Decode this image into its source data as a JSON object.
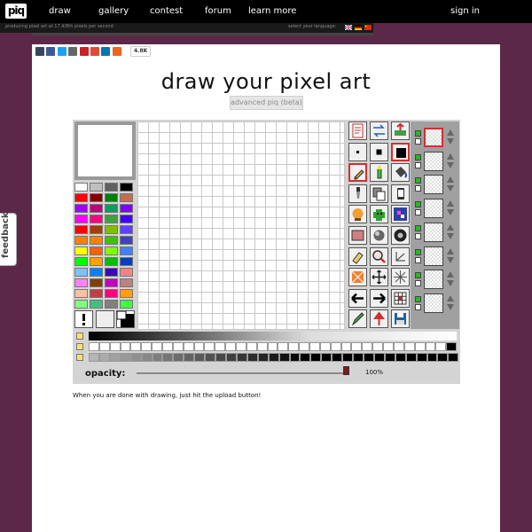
{
  "brand": {
    "logo_text": "piq"
  },
  "nav": {
    "items": [
      {
        "label": "draw"
      },
      {
        "label": "gallery"
      },
      {
        "label": "contest"
      },
      {
        "label": "forum"
      },
      {
        "label": "learn more"
      }
    ],
    "signin": "sign in"
  },
  "subbar": {
    "tagline": "producing pixel art at 17.4/8th pixels per second",
    "language_label": "select your language:",
    "flags": [
      "uk-flag",
      "de-flag",
      "cn-flag"
    ]
  },
  "share": {
    "buttons": [
      {
        "icon": "tumblr-icon",
        "color": "#36465d"
      },
      {
        "icon": "facebook-icon",
        "color": "#3b5998"
      },
      {
        "icon": "twitter-icon",
        "color": "#1da1f2"
      },
      {
        "icon": "email-icon",
        "color": "#666666"
      },
      {
        "icon": "pinterest-icon",
        "color": "#cb2027"
      },
      {
        "icon": "google-plus-icon",
        "color": "#dd4b39"
      },
      {
        "icon": "linkedin-icon",
        "color": "#0077b5"
      },
      {
        "icon": "share-plus-icon",
        "color": "#f16522"
      }
    ],
    "count": "4.8K"
  },
  "page": {
    "title": "draw your pixel art",
    "advanced_button": "advanced piq (beta)",
    "hint": "When you are done with drawing, just hit the upload button!"
  },
  "palette": {
    "colors": [
      [
        "#ffffff",
        "#c0c0c0",
        "#606060",
        "#000000"
      ],
      [
        "#ff0000",
        "#800000",
        "#008000",
        "#c07050"
      ],
      [
        "#a000ff",
        "#c00080",
        "#00a060",
        "#8000ff"
      ],
      [
        "#ff00ff",
        "#ff0080",
        "#40a040",
        "#4000ff"
      ],
      [
        "#ff0000",
        "#a04000",
        "#80c000",
        "#6040ff"
      ],
      [
        "#ff8000",
        "#ff8000",
        "#40c000",
        "#4040c0"
      ],
      [
        "#ffff00",
        "#ff6000",
        "#80ff00",
        "#4080ff"
      ],
      [
        "#00ff00",
        "#ffa000",
        "#00c000",
        "#0040c0"
      ],
      [
        "#80c0ff",
        "#0080ff",
        "#4000c0",
        "#ff8080"
      ],
      [
        "#ff80ff",
        "#804000",
        "#c000c0",
        "#c08080"
      ],
      [
        "#ffc0a0",
        "#c04040",
        "#ff0080",
        "#ffa000"
      ],
      [
        "#80ff80",
        "#40c080",
        "#808080",
        "#40ff40"
      ]
    ]
  },
  "tools": {
    "items": [
      {
        "name": "new-canvas-icon",
        "selected": false
      },
      {
        "name": "flip-icon",
        "selected": false
      },
      {
        "name": "upload-icon",
        "selected": false
      },
      {
        "name": "brush-small-icon",
        "selected": false
      },
      {
        "name": "brush-medium-icon",
        "selected": false
      },
      {
        "name": "brush-large-icon",
        "selected": true
      },
      {
        "name": "pencil-icon",
        "selected": true
      },
      {
        "name": "color-pencil-icon",
        "selected": false
      },
      {
        "name": "paint-bucket-icon",
        "selected": false
      },
      {
        "name": "dropper-icon",
        "selected": false
      },
      {
        "name": "copy-icon",
        "selected": false
      },
      {
        "name": "phone-icon",
        "selected": false
      },
      {
        "name": "stamp-icon",
        "selected": false
      },
      {
        "name": "sprite-icon",
        "selected": false
      },
      {
        "name": "pattern-icon",
        "selected": false
      },
      {
        "name": "fill-rect-icon",
        "selected": false
      },
      {
        "name": "sphere-icon",
        "selected": false
      },
      {
        "name": "gradient-icon",
        "selected": false
      },
      {
        "name": "eraser-icon",
        "selected": false
      },
      {
        "name": "zoom-icon",
        "selected": false
      },
      {
        "name": "line-icon",
        "selected": false
      },
      {
        "name": "dither-icon",
        "selected": false
      },
      {
        "name": "move-icon",
        "selected": false
      },
      {
        "name": "symmetry-icon",
        "selected": false
      },
      {
        "name": "arrow-left-icon",
        "selected": false
      },
      {
        "name": "arrow-right-icon",
        "selected": false
      },
      {
        "name": "grid-icon",
        "selected": false
      },
      {
        "name": "pen-icon",
        "selected": false
      },
      {
        "name": "upload-arrow-icon",
        "selected": false
      },
      {
        "name": "save-icon",
        "selected": false
      }
    ]
  },
  "layers": {
    "count": 8,
    "selected": 0
  },
  "opacity": {
    "label": "opacity:",
    "value_text": "100%",
    "value": 100
  }
}
